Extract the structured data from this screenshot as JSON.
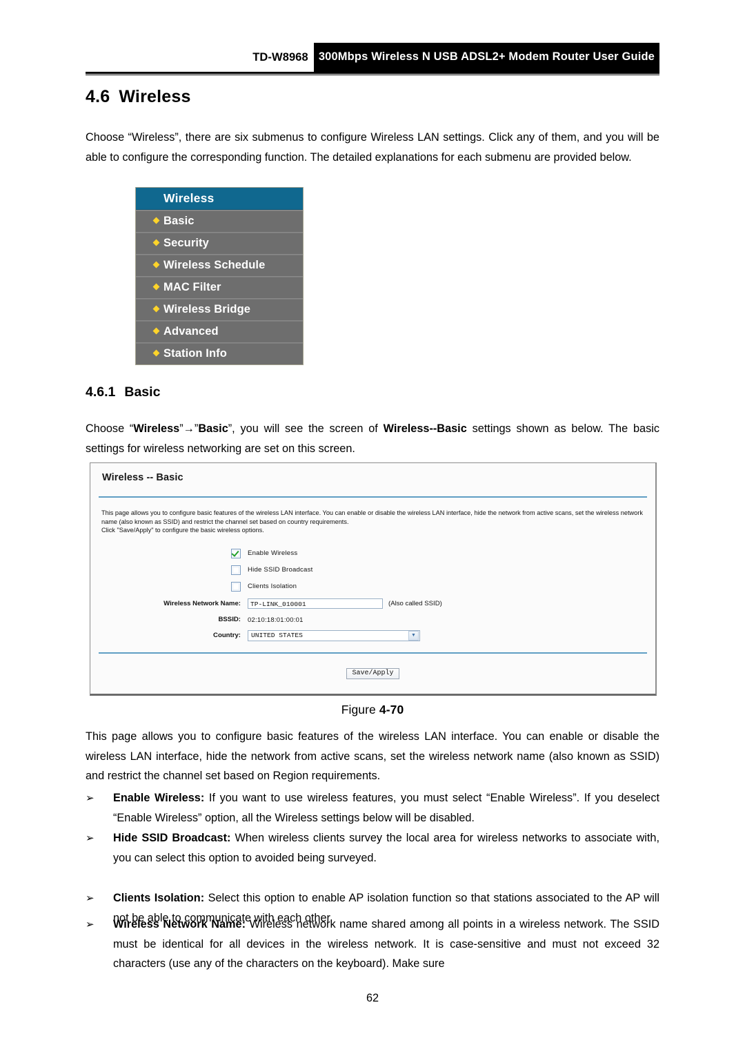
{
  "header": {
    "model": "TD-W8968",
    "title": "300Mbps Wireless N USB ADSL2+ Modem Router User Guide"
  },
  "section": {
    "number": "4.6",
    "title": "Wireless",
    "intro": "Choose “Wireless”, there are six submenus to configure Wireless LAN settings. Click any of them, and you will be able to configure the corresponding function. The detailed explanations for each submenu are provided below."
  },
  "nav_menu": {
    "header": "Wireless",
    "items": [
      {
        "label": "Basic"
      },
      {
        "label": "Security"
      },
      {
        "label": "Wireless Schedule"
      },
      {
        "label": "MAC Filter"
      },
      {
        "label": "Wireless Bridge"
      },
      {
        "label": "Advanced"
      },
      {
        "label": "Station Info"
      }
    ],
    "colors": {
      "header_bg": "#10688f",
      "item_bg": "#6e6e6e",
      "bullet": "#ffd42a",
      "text": "#ffffff"
    }
  },
  "subsection": {
    "number": "4.6.1",
    "title": "Basic",
    "intro_part1": "Choose “",
    "intro_bold1": "Wireless",
    "intro_arrow": "”→”",
    "intro_bold2": "Basic",
    "intro_part2": "”, you will see the screen of ",
    "intro_bold3": "Wireless--Basic",
    "intro_part3": " settings shown as below. The basic settings for wireless networking are set on this screen."
  },
  "ui_panel": {
    "title": "Wireless -- Basic",
    "description_line1": "This page allows you to configure basic features of the wireless LAN interface. You can enable or disable the wireless LAN interface, hide the network from active scans, set the wireless network",
    "description_line2": "name (also known as SSID) and restrict the channel set based on country requirements.",
    "description_line3": "Click \"Save/Apply\" to configure the basic wireless options.",
    "checkboxes": [
      {
        "label": "Enable Wireless",
        "checked": true
      },
      {
        "label": "Hide SSID Broadcast",
        "checked": false
      },
      {
        "label": "Clients Isolation",
        "checked": false
      }
    ],
    "fields": [
      {
        "label": "Wireless Network Name:",
        "value": "TP-LINK_010001",
        "hint": "(Also called SSID)"
      },
      {
        "label": "BSSID:",
        "value": "02:10:18:01:00:01"
      },
      {
        "label": "Country:",
        "value": "UNITED STATES"
      }
    ],
    "save_button": "Save/Apply"
  },
  "figure": {
    "caption_prefix": "Figure ",
    "caption_number": "4-70"
  },
  "body": {
    "description": "This page allows you to configure basic features of the wireless LAN interface. You can enable or disable the wireless LAN interface, hide the network from active scans, set the wireless network name (also known as SSID) and restrict the channel set based on Region requirements.",
    "bullets": [
      {
        "marker": "➢",
        "term": "Enable Wireless:",
        "text": " If you want to use wireless features, you must select “Enable Wireless”. If you deselect “Enable Wireless” option, all the Wireless settings below will be disabled."
      },
      {
        "marker": "➢",
        "term": "Hide SSID Broadcast:",
        "text": "  When wireless clients survey the local area for wireless networks to associate with, you can select this option to avoided being surveyed."
      },
      {
        "marker": "➢",
        "term": "Clients Isolation:",
        "text": " Select this option to enable AP isolation function so that stations associated to the AP will not be able to communicate with each other."
      },
      {
        "marker": "➢",
        "term": "Wireless Network Name:",
        "text": " Wireless network name shared among all points in a wireless network. The SSID must be identical for all devices in the wireless network. It is case-sensitive and must not exceed 32 characters (use any of the characters on the keyboard). Make sure"
      }
    ]
  },
  "page_number": "62"
}
